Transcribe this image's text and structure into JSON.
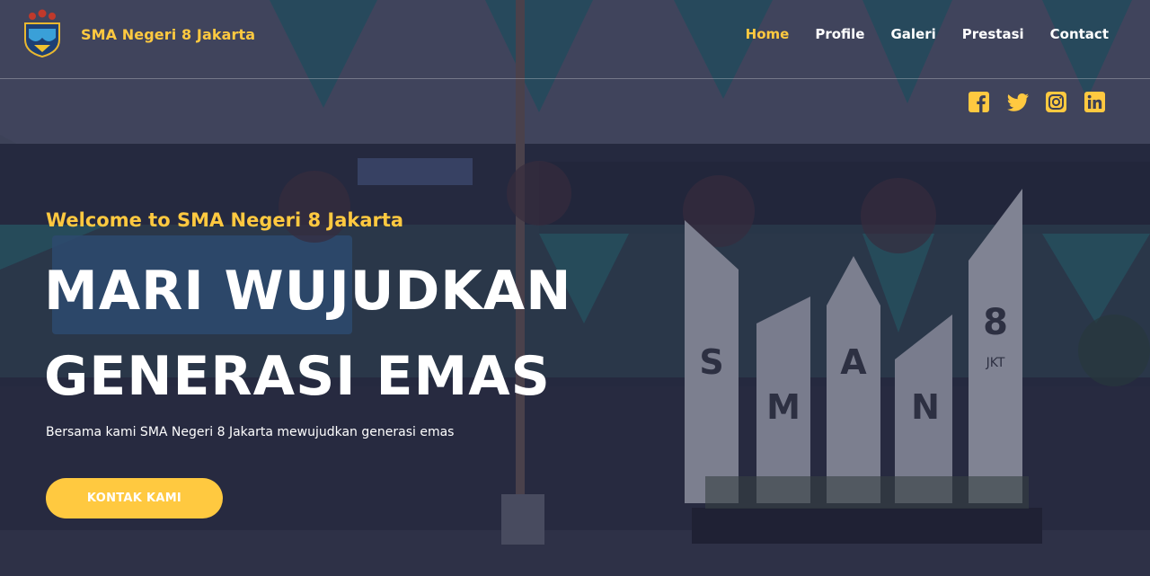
{
  "header": {
    "brand": "SMA Negeri 8 Jakarta",
    "logo_icon": "school-crest-icon",
    "nav": [
      {
        "label": "Home",
        "active": true
      },
      {
        "label": "Profile",
        "active": false
      },
      {
        "label": "Galeri",
        "active": false
      },
      {
        "label": "Prestasi",
        "active": false
      },
      {
        "label": "Contact",
        "active": false
      }
    ],
    "social": [
      "facebook-icon",
      "twitter-icon",
      "instagram-icon",
      "linkedin-icon"
    ]
  },
  "hero": {
    "eyebrow": "Welcome to SMA Negeri 8 Jakarta",
    "headline_line1": "MARI WUJUDKAN",
    "headline_line2": "GENERASI EMAS",
    "subtitle": "Bersama kami SMA Negeri 8 Jakarta mewujudkan generasi emas",
    "cta_label": "KONTAK KAMI"
  },
  "background": {
    "monument_letters": [
      "S",
      "M",
      "A",
      "N",
      "8",
      "JKT"
    ]
  },
  "colors": {
    "accent": "#ffc940",
    "text": "#ffffff",
    "overlay": "#1e223a"
  }
}
